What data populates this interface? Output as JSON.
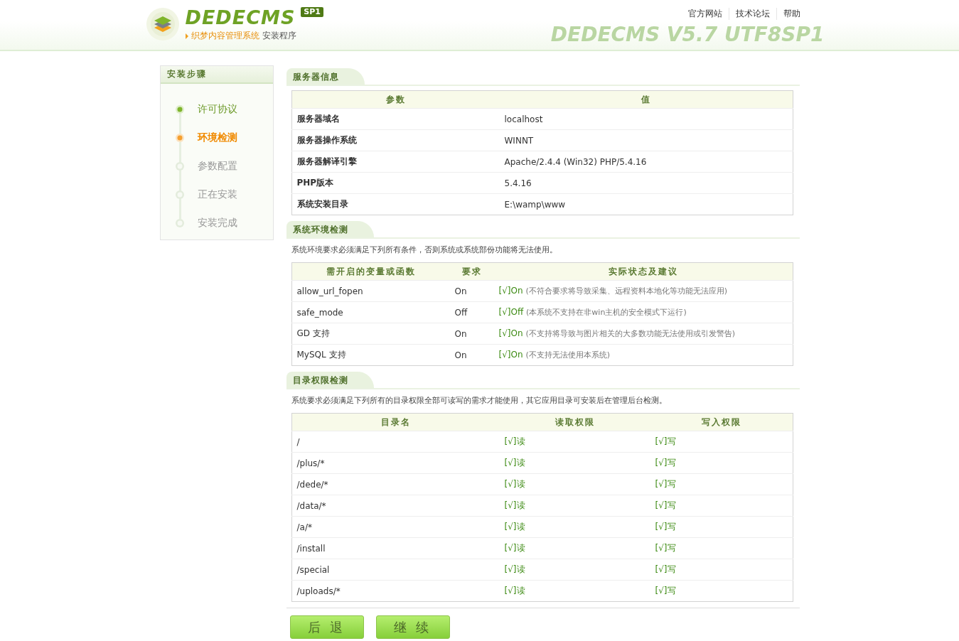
{
  "header": {
    "logo": "DEDECMS",
    "badge": "SP1",
    "product": "织梦内容管理系统",
    "subtitle": "安装程序",
    "version_banner": "DEDECMS V5.7 UTF8SP1",
    "links": [
      {
        "label": "官方网站"
      },
      {
        "label": "技术论坛"
      },
      {
        "label": "帮助"
      }
    ]
  },
  "sidebar": {
    "title": "安装步骤",
    "steps": [
      {
        "label": "许可协议",
        "kind": "done"
      },
      {
        "label": "环境检测",
        "kind": "current"
      },
      {
        "label": "参数配置",
        "kind": "pending"
      },
      {
        "label": "正在安装",
        "kind": "pending"
      },
      {
        "label": "安装完成",
        "kind": "pending"
      }
    ]
  },
  "server_info": {
    "title": "服务器信息",
    "columns": [
      "参数",
      "值"
    ],
    "rows": [
      [
        "服务器域名",
        "localhost"
      ],
      [
        "服务器操作系统",
        "WINNT"
      ],
      [
        "服务器解译引擎",
        "Apache/2.4.4 (Win32) PHP/5.4.16"
      ],
      [
        "PHP版本",
        "5.4.16"
      ],
      [
        "系统安装目录",
        "E:\\wamp\\www"
      ]
    ]
  },
  "environment": {
    "title": "系统环境检测",
    "description": "系统环境要求必须满足下列所有条件，否则系统或系统部份功能将无法使用。",
    "columns": [
      "需开启的变量或函数",
      "要求",
      "实际状态及建议"
    ],
    "rows": [
      {
        "name": "allow_url_fopen",
        "required": "On",
        "result": "[√]On",
        "note": "(不符合要求将导致采集、远程资料本地化等功能无法应用)"
      },
      {
        "name": "safe_mode",
        "required": "Off",
        "result": "[√]Off",
        "note": "(本系统不支持在非win主机的安全模式下运行)"
      },
      {
        "name": "GD 支持",
        "required": "On",
        "result": "[√]On",
        "note": "(不支持将导致与图片相关的大多数功能无法使用或引发警告)"
      },
      {
        "name": "MySQL 支持",
        "required": "On",
        "result": "[√]On",
        "note": "(不支持无法使用本系统)"
      }
    ]
  },
  "permissions": {
    "title": "目录权限检测",
    "description": "系统要求必须满足下列所有的目录权限全部可读写的需求才能使用，其它应用目录可安装后在管理后台检测。",
    "columns": [
      "目录名",
      "读取权限",
      "写入权限"
    ],
    "rows": [
      [
        "/",
        "[√]读",
        "[√]写"
      ],
      [
        "/plus/*",
        "[√]读",
        "[√]写"
      ],
      [
        "/dede/*",
        "[√]读",
        "[√]写"
      ],
      [
        "/data/*",
        "[√]读",
        "[√]写"
      ],
      [
        "/a/*",
        "[√]读",
        "[√]写"
      ],
      [
        "/install",
        "[√]读",
        "[√]写"
      ],
      [
        "/special",
        "[√]读",
        "[√]写"
      ],
      [
        "/uploads/*",
        "[√]读",
        "[√]写"
      ]
    ]
  },
  "buttons": [
    {
      "label": "后 退"
    },
    {
      "label": "继 续"
    }
  ]
}
